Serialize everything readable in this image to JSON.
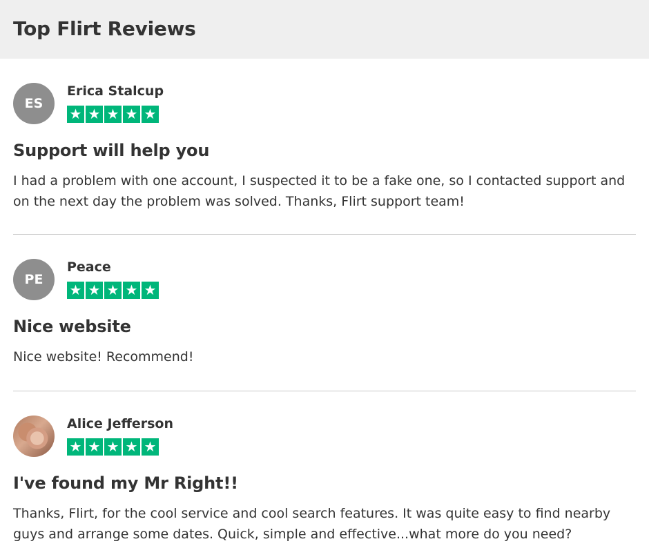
{
  "header": {
    "title": "Top Flirt Reviews"
  },
  "colors": {
    "star_green": "#00b67a",
    "avatar_gray": "#8e8e8e",
    "header_bg": "#efefef"
  },
  "reviews": [
    {
      "initials": "ES",
      "name": "Erica Stalcup",
      "rating": 5,
      "title": "Support will help you",
      "body": "I had a problem with one account, I suspected it to be a fake one, so I contacted support and on the next day the problem was solved. Thanks, Flirt support team!"
    },
    {
      "initials": "PE",
      "name": "Peace",
      "rating": 5,
      "title": "Nice website",
      "body": "Nice website! Recommend!"
    },
    {
      "avatar": "user-photo",
      "name": "Alice Jefferson",
      "rating": 5,
      "title": "I've found my Mr Right!!",
      "body": "Thanks, Flirt, for the cool service and cool search features. It was quite easy to find nearby guys and arrange some dates. Quick, simple and effective...what more do you need?"
    }
  ]
}
